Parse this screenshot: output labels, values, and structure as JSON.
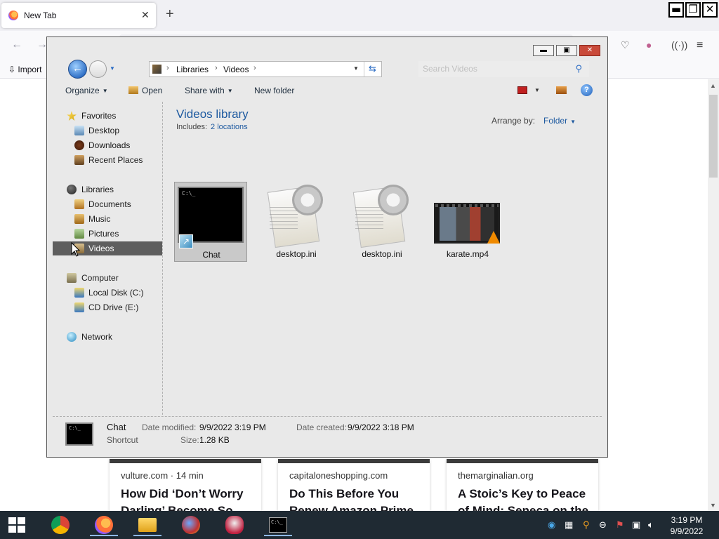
{
  "firefox": {
    "tab_title": "New Tab",
    "tab_close": "✕",
    "new_tab": "+",
    "bookmark_import": "Import",
    "window_controls": {
      "minimize": "▬",
      "maximize": "❐",
      "close": "✕"
    },
    "stories": [
      {
        "source": "vulture.com · 14 min",
        "headline": "How Did ‘Don’t Worry Darling’ Become So"
      },
      {
        "source": "capitaloneshopping.com",
        "headline": "Do This Before You Renew Amazon Prime"
      },
      {
        "source": "themarginalian.org",
        "headline": "A Stoic’s Key to Peace of Mind: Seneca on the"
      }
    ]
  },
  "explorer": {
    "caption": {
      "minimize": "▬",
      "maximize": "▣",
      "close": "✕"
    },
    "breadcrumb": [
      "Libraries",
      "Videos"
    ],
    "search_placeholder": "Search Videos",
    "toolbar": {
      "organize": "Organize",
      "open": "Open",
      "share_with": "Share with",
      "new_folder": "New folder"
    },
    "nav": {
      "favorites": "Favorites",
      "desktop": "Desktop",
      "downloads": "Downloads",
      "recent_places": "Recent Places",
      "libraries": "Libraries",
      "documents": "Documents",
      "music": "Music",
      "pictures": "Pictures",
      "videos": "Videos",
      "computer": "Computer",
      "local_disk": "Local Disk (C:)",
      "cd_drive": "CD Drive (E:)",
      "network": "Network"
    },
    "library": {
      "title": "Videos library",
      "includes_label": "Includes:",
      "includes_link": "2 locations",
      "arrange_label": "Arrange by:",
      "arrange_value": "Folder"
    },
    "files": [
      {
        "name": "Chat",
        "kind": "cmd-shortcut",
        "selected": true
      },
      {
        "name": "desktop.ini",
        "kind": "settings-file"
      },
      {
        "name": "desktop.ini",
        "kind": "settings-file"
      },
      {
        "name": "karate.mp4",
        "kind": "video"
      }
    ],
    "details": {
      "name": "Chat",
      "type": "Shortcut",
      "date_modified_label": "Date modified:",
      "date_modified": "9/9/2022 3:19 PM",
      "date_created_label": "Date created:",
      "date_created": "9/9/2022 3:18 PM",
      "size_label": "Size:",
      "size": "1.28 KB",
      "icon_text": "C:\\_"
    }
  },
  "taskbar": {
    "time": "3:19 PM",
    "date": "9/9/2022",
    "apps": [
      "chrome-icon",
      "firefox-icon",
      "file-explorer-icon",
      "paint-icon",
      "snipping-tool-icon",
      "command-prompt-icon"
    ]
  },
  "colors": {
    "accent": "#1e5aa0",
    "selected_nav": "#5e5e5e",
    "taskbar": "#1f2a33"
  }
}
